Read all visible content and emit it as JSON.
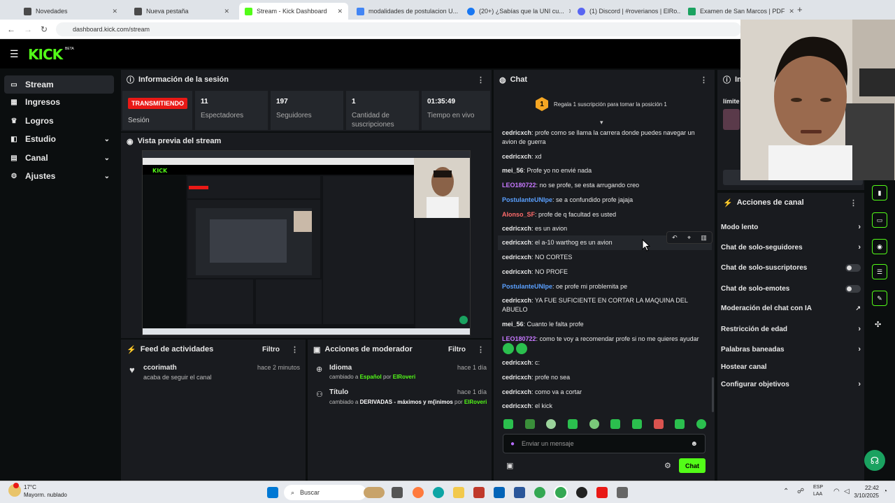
{
  "browser": {
    "tabs": [
      {
        "label": "Novedades",
        "color": "#4a4a4a"
      },
      {
        "label": "Nueva pestaña",
        "color": "#4a4a4a"
      },
      {
        "label": "Stream - Kick Dashboard",
        "color": "#53fc18"
      },
      {
        "label": "modalidades de postulacion U...",
        "color": "#4285f4"
      },
      {
        "label": "(20+) ¿Sabías que la UNI cu...",
        "color": "#1877f2"
      },
      {
        "label": "(1) Discord | #roverianos | ElRo...",
        "color": "#5865f2"
      },
      {
        "label": "Examen de San Marcos | PDF",
        "color": "#1aa260"
      }
    ],
    "url": "dashboard.kick.com/stream"
  },
  "kick": {
    "logo": "KICK",
    "beta": "BETA"
  },
  "sidebar": {
    "items": [
      {
        "label": "Stream",
        "icon": "stream-icon"
      },
      {
        "label": "Ingresos",
        "icon": "revenue-icon"
      },
      {
        "label": "Logros",
        "icon": "trophy-icon"
      },
      {
        "label": "Estudio",
        "icon": "studio-icon"
      },
      {
        "label": "Canal",
        "icon": "channel-icon"
      },
      {
        "label": "Ajustes",
        "icon": "gear-icon"
      }
    ]
  },
  "session": {
    "title": "Información de la sesión",
    "live_badge": "TRANSMITIENDO",
    "session_label": "Sesión",
    "stats": [
      {
        "value": "11",
        "label": "Espectadores"
      },
      {
        "value": "197",
        "label": "Seguidores"
      },
      {
        "value": "1",
        "label": "Cantidad de suscripciones"
      },
      {
        "value": "01:35:49",
        "label": "Tiempo en vivo"
      }
    ]
  },
  "preview": {
    "title": "Vista previa del stream"
  },
  "activity": {
    "title": "Feed de actividades",
    "filter": "Filtro",
    "items": [
      {
        "user": "ccorimath",
        "text": "acaba de seguir el canal",
        "time": "hace 2 minutos"
      }
    ]
  },
  "modactions": {
    "title": "Acciones de moderador",
    "filter": "Filtro",
    "items": [
      {
        "title": "Idioma",
        "time": "hace 1 día",
        "prefix": "cambiado a",
        "value": "Español",
        "by": "por",
        "mod": "ElRoveri"
      },
      {
        "title": "Título",
        "time": "hace 1 día",
        "prefix": "cambiado a",
        "value": "DERIVADAS - máximos y m{inimos",
        "by": "por",
        "mod": "ElRoveri"
      }
    ]
  },
  "chat": {
    "title": "Chat",
    "sub_rank": "1",
    "sub_banner": "Regala 1 suscripción para tomar la posición 1",
    "messages": [
      {
        "user": "cedricxch",
        "text": "profe como se llama la carrera donde puedes navegar un avion de guerra",
        "color": "#ffffff"
      },
      {
        "user": "cedricxch",
        "text": "xd",
        "color": "#ffffff"
      },
      {
        "user": "mei_56",
        "text": "Profe yo no envié nada",
        "color": "#ffffff"
      },
      {
        "user": "LEO180722",
        "text": "no se profe, se esta arrugando creo",
        "color": "#c678ff"
      },
      {
        "user": "PostulanteUNIpe",
        "text": "se a confundido profe jajaja",
        "color": "#5aa0ff"
      },
      {
        "user": "Alonso_SF",
        "text": "profe de q facultad es usted",
        "color": "#ff6b6b"
      },
      {
        "user": "cedricxch",
        "text": "es un avion",
        "color": "#ffffff"
      },
      {
        "user": "cedricxch",
        "text": "el a-10 warthog es un avion",
        "color": "#ffffff"
      },
      {
        "user": "cedricxch",
        "text": "NO CORTES",
        "color": "#ffffff"
      },
      {
        "user": "cedricxch",
        "text": "NO PROFE",
        "color": "#ffffff"
      },
      {
        "user": "PostulanteUNIpe",
        "text": "oe profe mi problemita pe",
        "color": "#5aa0ff"
      },
      {
        "user": "cedricxch",
        "text": "YA FUE SUFICIENTE EN CORTAR LA MAQUINA DEL ABUELO",
        "color": "#ffffff"
      },
      {
        "user": "mei_56",
        "text": "Cuanto le falta profe",
        "color": "#ffffff"
      },
      {
        "user": "LEO180722",
        "text": "como te voy a recomendar profe si no me quieres ayudar",
        "color": "#c678ff"
      },
      {
        "user": "cedricxch",
        "text": "c:",
        "color": "#ffffff"
      },
      {
        "user": "cedricxch",
        "text": "profe no sea",
        "color": "#ffffff"
      },
      {
        "user": "cedricxch",
        "text": "como va a cortar",
        "color": "#ffffff"
      },
      {
        "user": "cedricxch",
        "text": "el kick",
        "color": "#ffffff"
      }
    ],
    "input_placeholder": "Enviar un mensaje",
    "send_label": "Chat"
  },
  "channel_actions": {
    "title": "Acciones de canal",
    "items": [
      {
        "label": "Modo lento",
        "kind": "chevron"
      },
      {
        "label": "Chat de solo-seguidores",
        "kind": "chevron"
      },
      {
        "label": "Chat de solo-suscriptores",
        "kind": "toggle"
      },
      {
        "label": "Chat de solo-emotes",
        "kind": "toggle"
      },
      {
        "label": "Moderación del chat con IA",
        "kind": "external"
      },
      {
        "label": "Restricción de edad",
        "kind": "chevron"
      },
      {
        "label": "Palabras baneadas",
        "kind": "chevron"
      },
      {
        "label": "Hostear canal",
        "kind": "none"
      },
      {
        "label": "Configurar objetivos",
        "kind": "chevron"
      }
    ]
  },
  "info_panel": {
    "title": "Info",
    "snippet": "límite"
  },
  "taskbar": {
    "weather_temp": "17°C",
    "weather_desc": "Mayorm. nublado",
    "search": "Buscar",
    "lang1": "ESP",
    "lang2": "LAA",
    "time": "22:42",
    "date": "3/10/2025"
  },
  "colors": {
    "accent": "#53fc18",
    "live": "#e91916",
    "bg": "#0b0e0f",
    "panel": "#191b1f"
  }
}
